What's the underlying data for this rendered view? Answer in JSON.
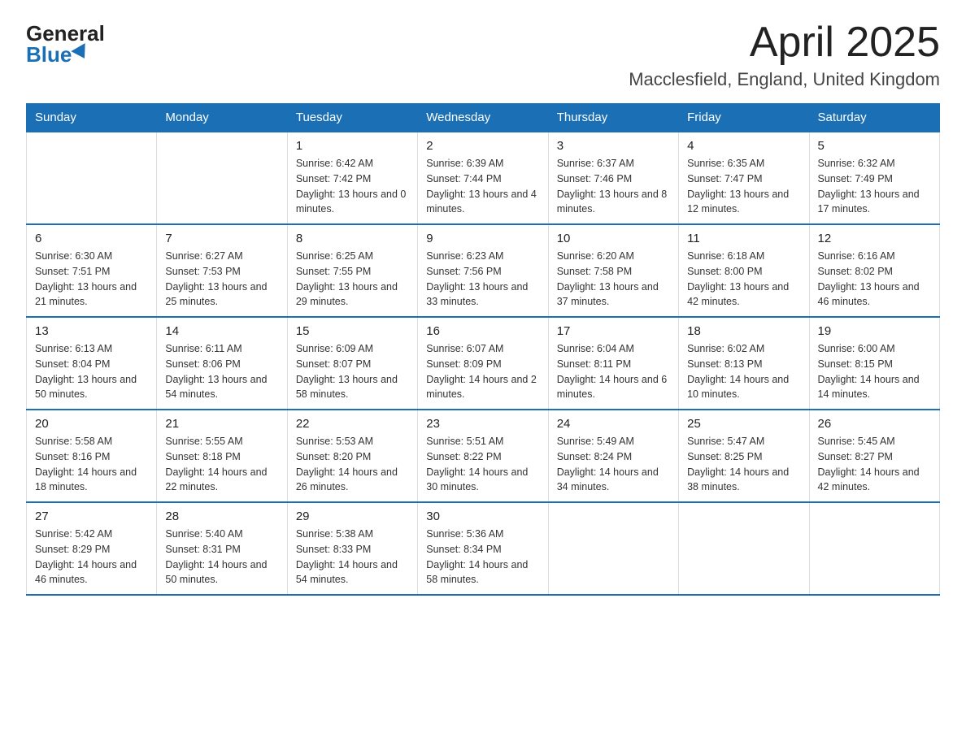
{
  "logo": {
    "general": "General",
    "blue": "Blue"
  },
  "header": {
    "month_title": "April 2025",
    "location": "Macclesfield, England, United Kingdom"
  },
  "days_of_week": [
    "Sunday",
    "Monday",
    "Tuesday",
    "Wednesday",
    "Thursday",
    "Friday",
    "Saturday"
  ],
  "weeks": [
    [
      {
        "day": "",
        "sunrise": "",
        "sunset": "",
        "daylight": ""
      },
      {
        "day": "",
        "sunrise": "",
        "sunset": "",
        "daylight": ""
      },
      {
        "day": "1",
        "sunrise": "Sunrise: 6:42 AM",
        "sunset": "Sunset: 7:42 PM",
        "daylight": "Daylight: 13 hours and 0 minutes."
      },
      {
        "day": "2",
        "sunrise": "Sunrise: 6:39 AM",
        "sunset": "Sunset: 7:44 PM",
        "daylight": "Daylight: 13 hours and 4 minutes."
      },
      {
        "day": "3",
        "sunrise": "Sunrise: 6:37 AM",
        "sunset": "Sunset: 7:46 PM",
        "daylight": "Daylight: 13 hours and 8 minutes."
      },
      {
        "day": "4",
        "sunrise": "Sunrise: 6:35 AM",
        "sunset": "Sunset: 7:47 PM",
        "daylight": "Daylight: 13 hours and 12 minutes."
      },
      {
        "day": "5",
        "sunrise": "Sunrise: 6:32 AM",
        "sunset": "Sunset: 7:49 PM",
        "daylight": "Daylight: 13 hours and 17 minutes."
      }
    ],
    [
      {
        "day": "6",
        "sunrise": "Sunrise: 6:30 AM",
        "sunset": "Sunset: 7:51 PM",
        "daylight": "Daylight: 13 hours and 21 minutes."
      },
      {
        "day": "7",
        "sunrise": "Sunrise: 6:27 AM",
        "sunset": "Sunset: 7:53 PM",
        "daylight": "Daylight: 13 hours and 25 minutes."
      },
      {
        "day": "8",
        "sunrise": "Sunrise: 6:25 AM",
        "sunset": "Sunset: 7:55 PM",
        "daylight": "Daylight: 13 hours and 29 minutes."
      },
      {
        "day": "9",
        "sunrise": "Sunrise: 6:23 AM",
        "sunset": "Sunset: 7:56 PM",
        "daylight": "Daylight: 13 hours and 33 minutes."
      },
      {
        "day": "10",
        "sunrise": "Sunrise: 6:20 AM",
        "sunset": "Sunset: 7:58 PM",
        "daylight": "Daylight: 13 hours and 37 minutes."
      },
      {
        "day": "11",
        "sunrise": "Sunrise: 6:18 AM",
        "sunset": "Sunset: 8:00 PM",
        "daylight": "Daylight: 13 hours and 42 minutes."
      },
      {
        "day": "12",
        "sunrise": "Sunrise: 6:16 AM",
        "sunset": "Sunset: 8:02 PM",
        "daylight": "Daylight: 13 hours and 46 minutes."
      }
    ],
    [
      {
        "day": "13",
        "sunrise": "Sunrise: 6:13 AM",
        "sunset": "Sunset: 8:04 PM",
        "daylight": "Daylight: 13 hours and 50 minutes."
      },
      {
        "day": "14",
        "sunrise": "Sunrise: 6:11 AM",
        "sunset": "Sunset: 8:06 PM",
        "daylight": "Daylight: 13 hours and 54 minutes."
      },
      {
        "day": "15",
        "sunrise": "Sunrise: 6:09 AM",
        "sunset": "Sunset: 8:07 PM",
        "daylight": "Daylight: 13 hours and 58 minutes."
      },
      {
        "day": "16",
        "sunrise": "Sunrise: 6:07 AM",
        "sunset": "Sunset: 8:09 PM",
        "daylight": "Daylight: 14 hours and 2 minutes."
      },
      {
        "day": "17",
        "sunrise": "Sunrise: 6:04 AM",
        "sunset": "Sunset: 8:11 PM",
        "daylight": "Daylight: 14 hours and 6 minutes."
      },
      {
        "day": "18",
        "sunrise": "Sunrise: 6:02 AM",
        "sunset": "Sunset: 8:13 PM",
        "daylight": "Daylight: 14 hours and 10 minutes."
      },
      {
        "day": "19",
        "sunrise": "Sunrise: 6:00 AM",
        "sunset": "Sunset: 8:15 PM",
        "daylight": "Daylight: 14 hours and 14 minutes."
      }
    ],
    [
      {
        "day": "20",
        "sunrise": "Sunrise: 5:58 AM",
        "sunset": "Sunset: 8:16 PM",
        "daylight": "Daylight: 14 hours and 18 minutes."
      },
      {
        "day": "21",
        "sunrise": "Sunrise: 5:55 AM",
        "sunset": "Sunset: 8:18 PM",
        "daylight": "Daylight: 14 hours and 22 minutes."
      },
      {
        "day": "22",
        "sunrise": "Sunrise: 5:53 AM",
        "sunset": "Sunset: 8:20 PM",
        "daylight": "Daylight: 14 hours and 26 minutes."
      },
      {
        "day": "23",
        "sunrise": "Sunrise: 5:51 AM",
        "sunset": "Sunset: 8:22 PM",
        "daylight": "Daylight: 14 hours and 30 minutes."
      },
      {
        "day": "24",
        "sunrise": "Sunrise: 5:49 AM",
        "sunset": "Sunset: 8:24 PM",
        "daylight": "Daylight: 14 hours and 34 minutes."
      },
      {
        "day": "25",
        "sunrise": "Sunrise: 5:47 AM",
        "sunset": "Sunset: 8:25 PM",
        "daylight": "Daylight: 14 hours and 38 minutes."
      },
      {
        "day": "26",
        "sunrise": "Sunrise: 5:45 AM",
        "sunset": "Sunset: 8:27 PM",
        "daylight": "Daylight: 14 hours and 42 minutes."
      }
    ],
    [
      {
        "day": "27",
        "sunrise": "Sunrise: 5:42 AM",
        "sunset": "Sunset: 8:29 PM",
        "daylight": "Daylight: 14 hours and 46 minutes."
      },
      {
        "day": "28",
        "sunrise": "Sunrise: 5:40 AM",
        "sunset": "Sunset: 8:31 PM",
        "daylight": "Daylight: 14 hours and 50 minutes."
      },
      {
        "day": "29",
        "sunrise": "Sunrise: 5:38 AM",
        "sunset": "Sunset: 8:33 PM",
        "daylight": "Daylight: 14 hours and 54 minutes."
      },
      {
        "day": "30",
        "sunrise": "Sunrise: 5:36 AM",
        "sunset": "Sunset: 8:34 PM",
        "daylight": "Daylight: 14 hours and 58 minutes."
      },
      {
        "day": "",
        "sunrise": "",
        "sunset": "",
        "daylight": ""
      },
      {
        "day": "",
        "sunrise": "",
        "sunset": "",
        "daylight": ""
      },
      {
        "day": "",
        "sunrise": "",
        "sunset": "",
        "daylight": ""
      }
    ]
  ]
}
